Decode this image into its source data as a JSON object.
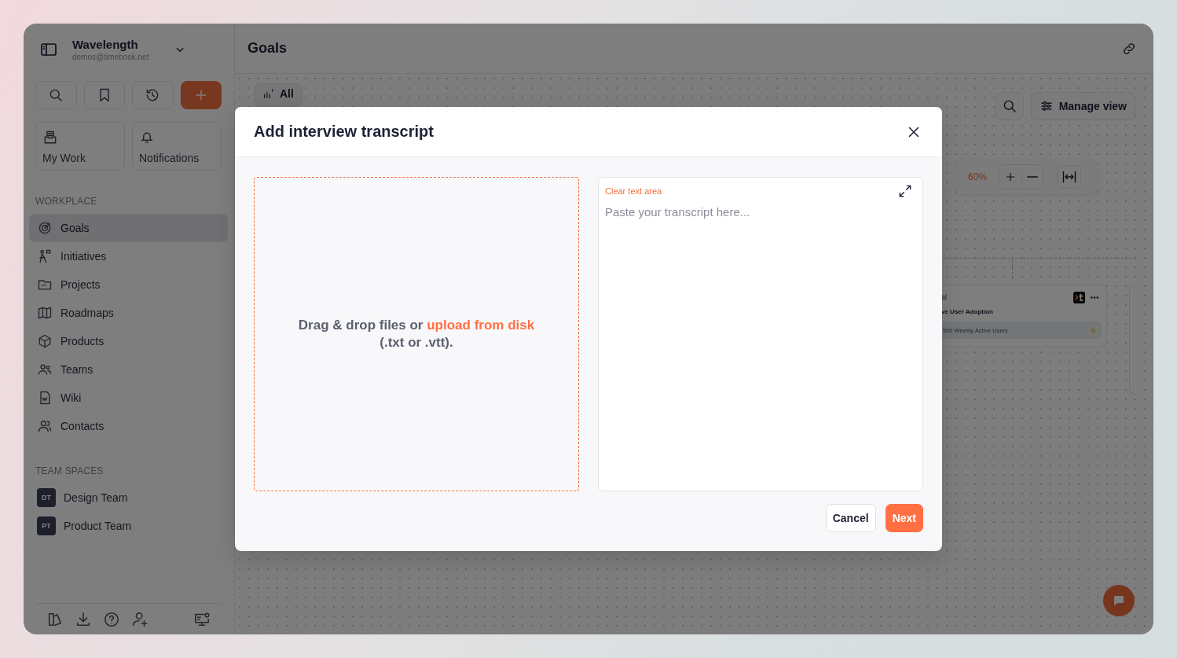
{
  "workspace": {
    "name": "Wavelength",
    "email": "demos@timebook.net"
  },
  "tiles": [
    {
      "label": "My Work"
    },
    {
      "label": "Notifications"
    }
  ],
  "sections": [
    {
      "heading": "WORKPLACE",
      "items": [
        {
          "label": "Goals",
          "selected": true
        },
        {
          "label": "Initiatives",
          "selected": false
        },
        {
          "label": "Projects",
          "selected": false
        },
        {
          "label": "Roadmaps",
          "selected": false
        },
        {
          "label": "Products",
          "selected": false
        },
        {
          "label": "Teams",
          "selected": false
        },
        {
          "label": "Wiki",
          "selected": false
        },
        {
          "label": "Contacts",
          "selected": false
        }
      ]
    },
    {
      "heading": "TEAM SPACES",
      "items": [
        {
          "label": "Design Team",
          "badge": "DT",
          "selected": false
        },
        {
          "label": "Product Team",
          "badge": "PT",
          "selected": false
        }
      ]
    }
  ],
  "main": {
    "title": "Goals",
    "filter_tab": "All",
    "manage_view": "Manage view",
    "zoom": "60%",
    "card": {
      "label": "al",
      "title": "ve User Adoption",
      "metric": "500 Weekly Active Users"
    }
  },
  "modal": {
    "title": "Add interview transcript",
    "dropzone": {
      "text": "Drag & drop files or",
      "link": "upload from disk",
      "text_after": "(.txt or .vtt)."
    },
    "textarea": {
      "clear_label": "Clear text area",
      "placeholder": "Paste your transcript here..."
    },
    "buttons": [
      {
        "label": "Cancel",
        "kind": "secondary"
      },
      {
        "label": "Next",
        "kind": "primary"
      }
    ]
  }
}
